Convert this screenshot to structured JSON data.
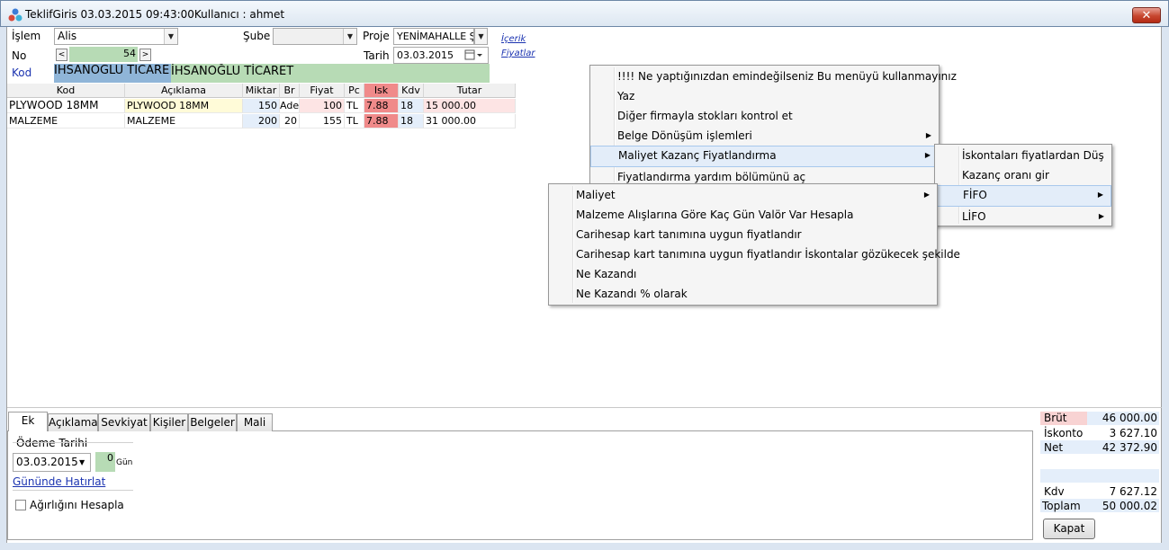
{
  "window": {
    "title": "TeklifGiris  03.03.2015 09:43:00Kullanıcı :  ahmet",
    "close_glyph": "✕"
  },
  "form": {
    "islem_label": "İşlem",
    "islem_value": "Alis",
    "sube_label": "Şube",
    "sube_value": "",
    "proje_label": "Proje",
    "proje_value": "YENİMAHALLE Ş",
    "no_label": "No",
    "no_value": "54",
    "prev_glyph": "<",
    "next_glyph": ">",
    "tarih_label": "Tarih",
    "tarih_value": "03.03.2015",
    "kod_label": "Kod",
    "kod_value": "İHSANOĞLU TİCARE",
    "firma_value": "İHSANOĞLU TİCARET",
    "icerik_link": "İçerik",
    "fiyatlar_link": "Fiyatlar"
  },
  "grid": {
    "headers": [
      "Kod",
      "Açıklama",
      "Miktar",
      "Br",
      "Fiyat",
      "Pc",
      "Isk",
      "Kdv",
      "Tutar"
    ],
    "rows": [
      {
        "kod": "PLYWOOD 18MM",
        "aciklama": "PLYWOOD 18MM",
        "miktar": "150",
        "br": "Adet",
        "fiyat": "100",
        "pc": "TL",
        "isk": "7.88",
        "kdv": "18",
        "tutar": "15 000.00"
      },
      {
        "kod": "MALZEME",
        "aciklama": "MALZEME",
        "miktar": "200",
        "br": "20",
        "fiyat": "155",
        "pc": "TL",
        "isk": "7.88",
        "kdv": "18",
        "tutar": "31 000.00"
      }
    ]
  },
  "context_menu": {
    "items": [
      {
        "label": "!!!!  Ne yaptığınızdan emindeğilseniz Bu menüyü kullanmayınız",
        "sub": ""
      },
      {
        "label": "Yaz",
        "sub": ""
      },
      {
        "label": "Diğer firmayla stokları kontrol et",
        "sub": ""
      },
      {
        "label": "Belge Dönüşüm işlemleri",
        "sub": "▶"
      },
      {
        "label": "Maliyet Kazanç Fiyatlandırma",
        "sub": "▶"
      },
      {
        "label": "Fiyatlandırma yardım bölümünü aç",
        "sub": ""
      }
    ]
  },
  "submenu1": {
    "items": [
      {
        "label": "İskontaları fiyatlardan Düş",
        "sub": ""
      },
      {
        "label": "Kazanç oranı gir",
        "sub": ""
      },
      {
        "label": "FİFO",
        "sub": "▶"
      },
      {
        "label": "LİFO",
        "sub": "▶"
      }
    ]
  },
  "submenu2": {
    "items": [
      {
        "label": "Maliyet",
        "sub": "▶"
      },
      {
        "label": "Malzeme Alışlarına Göre Kaç Gün Valör Var Hesapla",
        "sub": ""
      },
      {
        "label": "Carihesap kart tanımına uygun fiyatlandır",
        "sub": ""
      },
      {
        "label": "Carihesap kart tanımına uygun fiyatlandır İskontalar gözükecek şekilde",
        "sub": ""
      },
      {
        "label": "Ne Kazandı",
        "sub": ""
      },
      {
        "label": "Ne Kazandı % olarak",
        "sub": ""
      }
    ]
  },
  "tabs": [
    "Ek",
    "Açıklama",
    "Sevkiyat",
    "Kişiler",
    "Belgeler",
    "Mali"
  ],
  "ek_panel": {
    "odeme_tarihi_label": "Ödeme Tarihi",
    "odeme_tarihi_value": "03.03.2015",
    "gun_value": "0",
    "gun_label": "Gün",
    "hatirlat_link": "Gününde Hatırlat",
    "agirlik_label": "Ağırlığını Hesapla"
  },
  "summary": {
    "brut_label": "Brüt",
    "brut_value": "46 000.00",
    "iskonto_label": "İskonto",
    "iskonto_value": "3 627.10",
    "net_label": "Net",
    "net_value": "42 372.90",
    "kdv_label": "Kdv",
    "kdv_value": "7 627.12",
    "toplam_label": "Toplam",
    "toplam_value": "50 000.02",
    "kapat_label": "Kapat"
  },
  "colors": {
    "accent_green": "#b7dbb5",
    "accent_blue": "#8fb5d8",
    "isk_red": "#f08a8a",
    "brut_pink": "#f8d3d3",
    "link": "#1b33b0"
  }
}
